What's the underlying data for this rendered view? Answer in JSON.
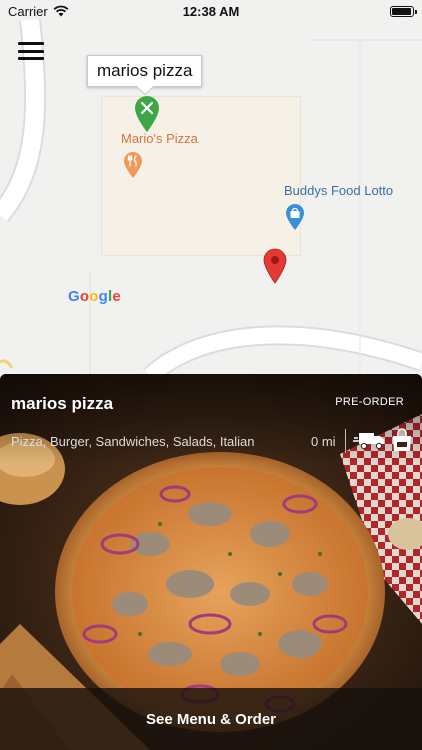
{
  "status_bar": {
    "carrier": "Carrier",
    "time": "12:38 AM",
    "wifi_icon": "wifi-icon",
    "battery_icon": "battery-icon",
    "battery_level": 0.95
  },
  "map": {
    "menu_icon": "hamburger-menu-icon",
    "callout_title": "marios pizza",
    "places": {
      "marios_label": "Mario's Pizza",
      "buddys_label": "Buddys Food Lotto"
    },
    "pins": {
      "selected_restaurant_icon": "restaurant-pin-icon",
      "marios_icon": "fork-knife-pin-icon",
      "buddys_icon": "shopping-pin-icon",
      "location_icon": "location-pin-icon"
    },
    "attribution": "Google",
    "colors": {
      "selected_pin": "#3fa648",
      "marios_pin": "#f09a5a",
      "buddys_pin": "#3b8fd9",
      "location_pin": "#e53935"
    }
  },
  "restaurant": {
    "name": "marios pizza",
    "order_mode": "PRE-ORDER",
    "cuisines": "Pizza, Burger, Sandwiches, Salads, Italian",
    "distance": "0 mi",
    "delivery_icon": "delivery-truck-icon",
    "takeout_icon": "shopping-bag-icon",
    "photo_icon": "pizza-photo"
  },
  "cta": {
    "label": "See Menu & Order"
  }
}
